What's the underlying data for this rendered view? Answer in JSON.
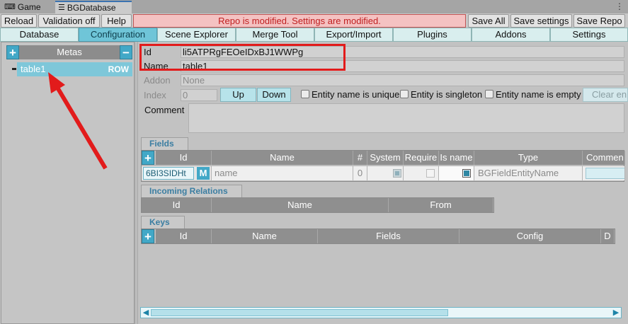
{
  "window_tabs": [
    {
      "label": "Game",
      "icon": "gamepad-icon"
    },
    {
      "label": "BGDatabase",
      "icon": "list-icon"
    }
  ],
  "toolbar": {
    "reload": "Reload",
    "validation": "Validation off",
    "help": "Help",
    "status": "Repo is modified. Settings are modified.",
    "save_all": "Save All",
    "save_settings": "Save settings",
    "save_repo": "Save Repo"
  },
  "nav_tabs": [
    "Database",
    "Configuration",
    "Scene Explorer",
    "Merge Tool",
    "Export/Import",
    "Plugins",
    "Addons",
    "Settings"
  ],
  "nav_active": "Configuration",
  "metas": {
    "title": "Metas",
    "items": [
      {
        "name": "table1",
        "type": "ROW"
      }
    ]
  },
  "meta_form": {
    "id_label": "Id",
    "id_value": "li5ATPRgFEOeIDxBJ1WWPg",
    "name_label": "Name",
    "name_value": "table1",
    "addon_label": "Addon",
    "addon_value": "None",
    "index_label": "Index",
    "index_value": "0",
    "up": "Up",
    "down": "Down",
    "cb_unique": "Entity name is unique",
    "cb_singleton": "Entity is singleton",
    "cb_empty": "Entity name is empty",
    "clear": "Clear en",
    "comment_label": "Comment"
  },
  "fields": {
    "tab": "Fields",
    "columns": [
      "Id",
      "Name",
      "#",
      "System",
      "Require",
      "Is name",
      "Type",
      "Commen"
    ],
    "rows": [
      {
        "id": "6BI3SIDHt",
        "badge": "M",
        "name": "name",
        "index": "0",
        "system": true,
        "require": false,
        "is_name": true,
        "type": "BGFieldEntityName"
      }
    ]
  },
  "incoming": {
    "tab": "Incoming Relations",
    "columns": [
      "Id",
      "Name",
      "From"
    ]
  },
  "keys": {
    "tab": "Keys",
    "columns": [
      "Id",
      "Name",
      "Fields",
      "Config",
      "D"
    ]
  },
  "colors": {
    "accent": "#42a8c7",
    "active_tab": "#6fc5d8",
    "status_bg": "#f4c2c2",
    "status_text": "#c02020",
    "highlight": "#e21b1b"
  }
}
